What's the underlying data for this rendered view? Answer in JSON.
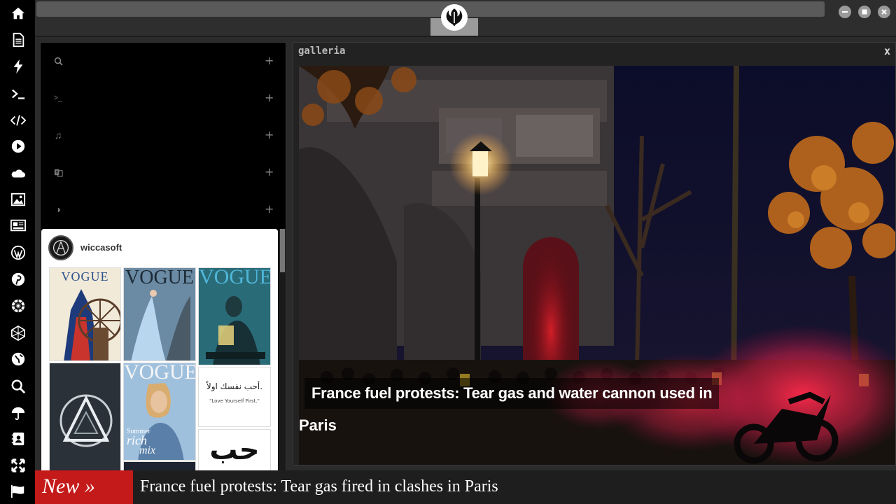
{
  "sidebar": {
    "icons": [
      "home-icon",
      "document-icon",
      "bolt-icon",
      "terminal-icon",
      "code-icon",
      "play-icon",
      "cloud-icon",
      "image-icon",
      "newspaper-icon",
      "wordpress-icon",
      "pinterest-icon",
      "settings-wheel-icon",
      "network-icon",
      "globe-icon",
      "search-icon",
      "umbrella-icon",
      "contact-icon",
      "expand-icon",
      "flag-icon"
    ]
  },
  "menu": {
    "rows": [
      {
        "icon": "search-icon",
        "glyph": "⚲",
        "plus": "+"
      },
      {
        "icon": "terminal-icon",
        "glyph": ">_",
        "plus": "+"
      },
      {
        "icon": "music-icon",
        "glyph": "♫",
        "plus": "+"
      },
      {
        "icon": "translate-icon",
        "glyph": "⌘",
        "plus": "+"
      },
      {
        "icon": "contrast-icon",
        "glyph": "◑",
        "plus": "+"
      }
    ]
  },
  "pinterest": {
    "username": "wiccasoft",
    "pins": {
      "vogue1": "VOGUE",
      "vogue2": "VOGUE",
      "vogue3": "VOGUE",
      "vogue4": "VOGUE",
      "mix1": "Summer",
      "mix2": "rich",
      "mix3": "mix",
      "arabic": "أحب نفسك اولاً.",
      "arabic_en": "\"Love Yourself First.\"",
      "arabic_big": "حب"
    }
  },
  "galleria": {
    "title": "galleria",
    "close": "x",
    "caption_line1": "France fuel protests: Tear gas and water cannon used in",
    "caption_line2": "Paris"
  },
  "ticker": {
    "badge": "New »",
    "headline": "France fuel protests: Tear gas fired in clashes in Paris"
  },
  "colors": {
    "accent_red": "#c41a1a",
    "sidebar_bg": "#000000",
    "chrome_bg": "#2e2e2e"
  }
}
